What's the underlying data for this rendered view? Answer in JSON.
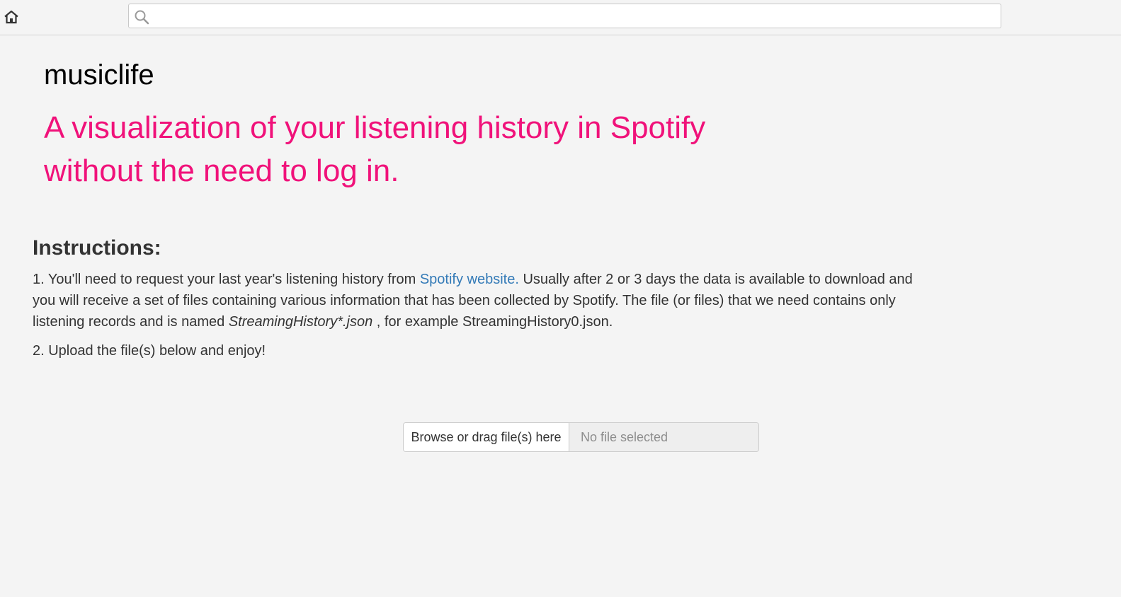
{
  "topbar": {
    "home_icon": "home-icon",
    "search_icon": "search-icon",
    "search_value": "",
    "search_placeholder": ""
  },
  "app": {
    "title": "musiclife",
    "tagline": "A visualization of your listening history in Spotify without the need to log in."
  },
  "instructions": {
    "heading": "Instructions:",
    "step1_pre": "1. You'll need to request your last year's listening history from ",
    "step1_link": "Spotify website.",
    "step1_mid": " Usually after 2 or 3 days the data is available to download and you will receive a set of files containing various information that has been collected by Spotify. The file (or files) that we need contains only listening records and is named ",
    "step1_filename": "StreamingHistory*.json",
    "step1_post": " , for example StreamingHistory0.json.",
    "step2": "2. Upload the file(s) below and enjoy!"
  },
  "upload": {
    "browse_label": "Browse or drag file(s) here",
    "status": "No file selected"
  },
  "colors": {
    "accent_pink": "#f0127a",
    "link_blue": "#337ab7"
  }
}
